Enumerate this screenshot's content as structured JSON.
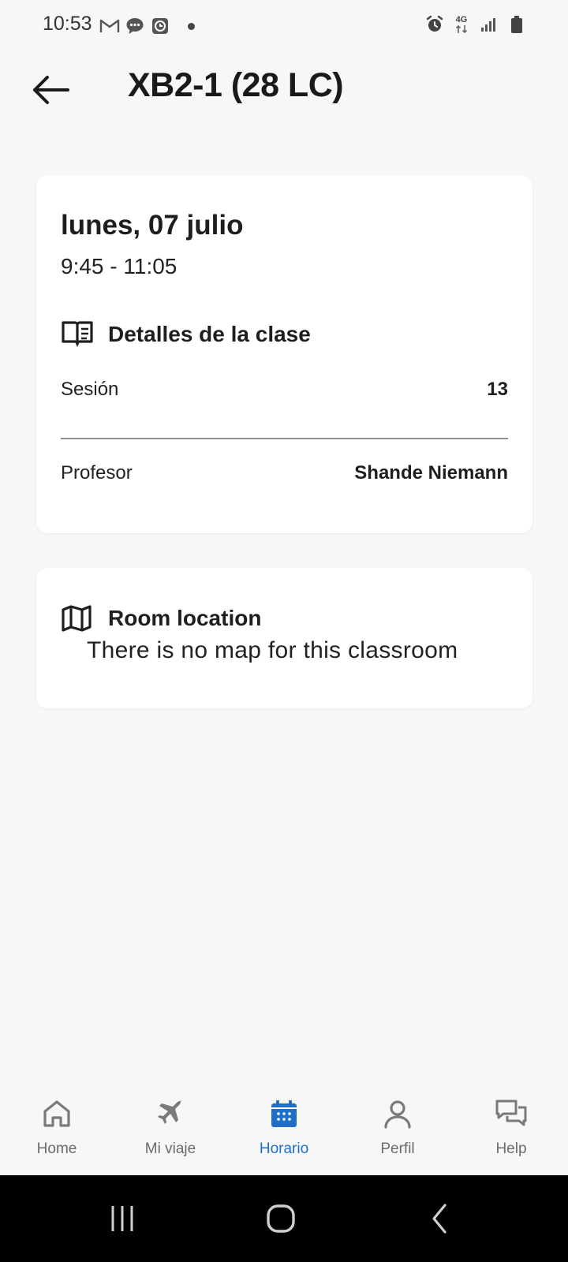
{
  "status_bar": {
    "time": "10:53",
    "network": "4G"
  },
  "header": {
    "title": "XB2-1 (28 LC)"
  },
  "class_card": {
    "date": "lunes, 07 julio",
    "time_range": "9:45 - 11:05",
    "section_title": "Detalles de la clase",
    "session_label": "Sesión",
    "session_value": "13",
    "teacher_label": "Profesor",
    "teacher_value": "Shande Niemann"
  },
  "room_card": {
    "title": "Room location",
    "message": "There is no map for this classroom"
  },
  "bottom_nav": {
    "active_color": "#1f6fc5",
    "items": [
      {
        "label": "Home",
        "icon": "home-icon"
      },
      {
        "label": "Mi viaje",
        "icon": "plane-icon"
      },
      {
        "label": "Horario",
        "icon": "calendar-icon",
        "active": true
      },
      {
        "label": "Perfil",
        "icon": "user-icon"
      },
      {
        "label": "Help",
        "icon": "chat-icon"
      }
    ]
  }
}
